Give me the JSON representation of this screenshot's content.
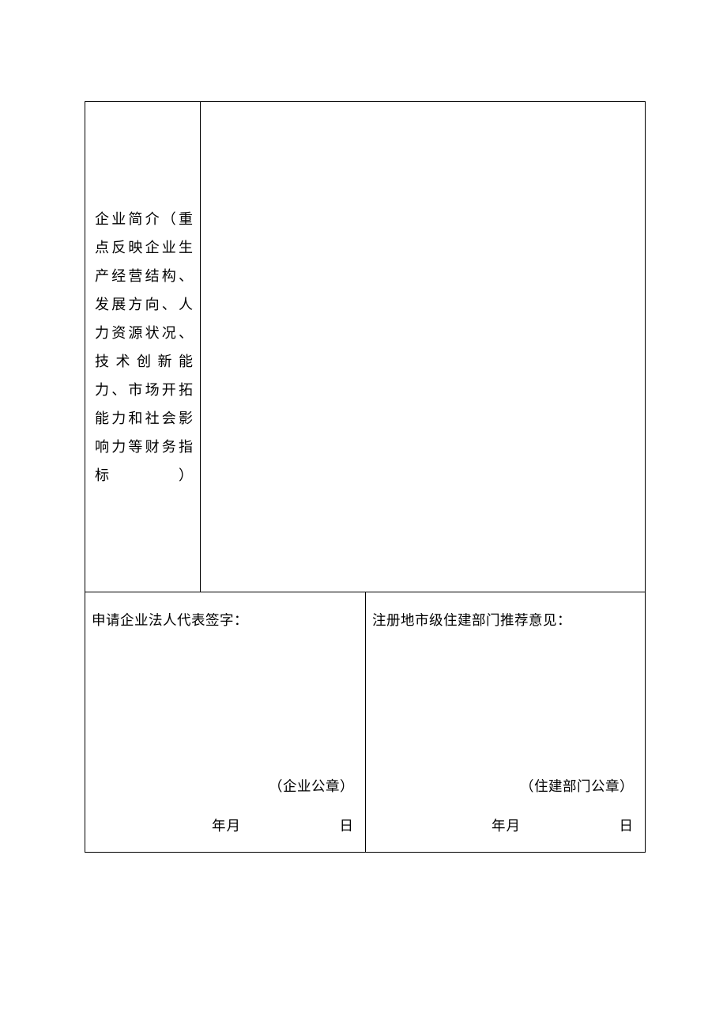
{
  "intro": {
    "label": "企业简介（重点反映企业生产经营结构、发展方向、人力资源状况、技术创新能力、市场开拓能力和社会影响力等财务指标）"
  },
  "signature": {
    "left_title": "申请企业法人代表签字：",
    "right_title": "注册地市级住建部门推荐意见：",
    "left_seal": "（企业公章）",
    "right_seal": "（住建部门公章）",
    "date_ym": "年月",
    "date_d": "日"
  }
}
